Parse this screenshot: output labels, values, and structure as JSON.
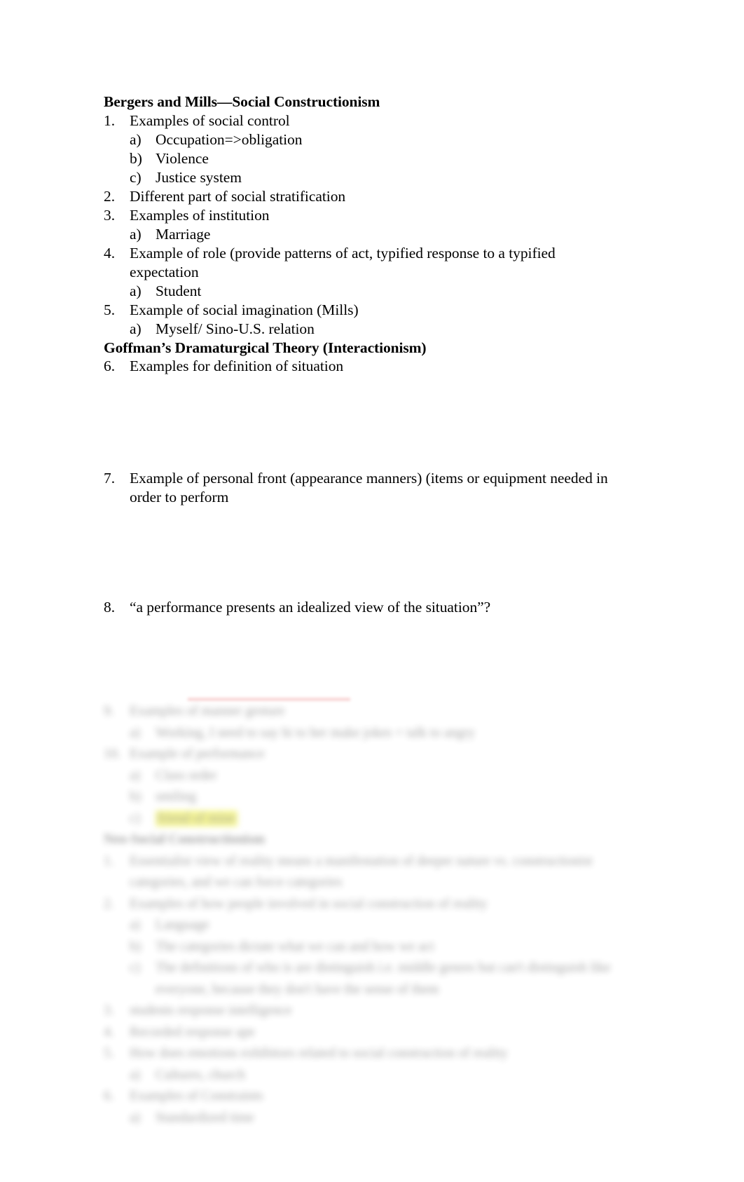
{
  "document": {
    "sections": [
      {
        "id": "section-1",
        "heading": "Bergers and Mills—Social Constructionism",
        "items": [
          {
            "marker": "1.",
            "level": 1,
            "text": "Examples of social control"
          },
          {
            "marker": "a)",
            "level": 2,
            "text": "Occupation=>obligation"
          },
          {
            "marker": "b)",
            "level": 2,
            "text": "Violence"
          },
          {
            "marker": "c)",
            "level": 2,
            "text": "Justice system"
          },
          {
            "marker": "2.",
            "level": 1,
            "text": "Different part of social stratification"
          },
          {
            "marker": "3.",
            "level": 1,
            "text": "Examples of institution"
          },
          {
            "marker": "a)",
            "level": 2,
            "text": "Marriage"
          },
          {
            "marker": "4.",
            "level": 1,
            "text": "Example of role (provide patterns of act, typified response to a typified expectation"
          },
          {
            "marker": "a)",
            "level": 2,
            "text": "Student"
          },
          {
            "marker": "5.",
            "level": 1,
            "text": "Example of social imagination (Mills)"
          },
          {
            "marker": "a)",
            "level": 2,
            "text": "Myself/ Sino-U.S. relation"
          }
        ]
      },
      {
        "id": "section-2",
        "heading": "Goffman’s Dramaturgical Theory (Interactionism)",
        "items": [
          {
            "marker": "6.",
            "level": 1,
            "text": "Examples for definition of situation"
          },
          {
            "marker": "7.",
            "level": 1,
            "text": "Example of personal front (appearance manners) (items or equipment needed in order to perform"
          },
          {
            "marker": "8.",
            "level": 1,
            "text": "“a performance presents an idealized view of the situation”?"
          }
        ]
      }
    ],
    "blurred_sections": [
      {
        "id": "blurred-section-1",
        "heading": "",
        "items": [
          {
            "marker": "9.",
            "level": 1,
            "text": "Examples of manner gesture"
          },
          {
            "marker": "a)",
            "level": 2,
            "text": "Working, I need to say hi to her make jokes + talk to angry"
          },
          {
            "marker": "10.",
            "level": 1,
            "text": "Example of performance"
          },
          {
            "marker": "a)",
            "level": 2,
            "text": "Class  order"
          },
          {
            "marker": "b)",
            "level": 2,
            "text": "smiling"
          },
          {
            "marker": "c)",
            "level": 2,
            "text": "friend of mine",
            "highlight": true
          }
        ]
      },
      {
        "id": "blurred-section-2",
        "heading": "Neo-Social Constructionism",
        "items": [
          {
            "marker": "1.",
            "level": 1,
            "text": "Essentialist view of reality means a manifestation of deeper nature vs. constructionist categories, and we can force categories"
          },
          {
            "marker": "2.",
            "level": 1,
            "text": "Examples of how people involved in social construction of reality"
          },
          {
            "marker": "a)",
            "level": 2,
            "text": "Language"
          },
          {
            "marker": "b)",
            "level": 2,
            "text": "The categories dictate what we can and how we act"
          },
          {
            "marker": "c)",
            "level": 2,
            "text": "The definitions of who is are distinguish i.e. middle genres but can't distinguish like everyone, because they don't have the sense of them"
          },
          {
            "marker": "3.",
            "level": 1,
            "text": "students response intelligence"
          },
          {
            "marker": "4.",
            "level": 1,
            "text": "Recorded response ape"
          },
          {
            "marker": "5.",
            "level": 1,
            "text": "How does emotions exhibitors related to social construction of reality"
          },
          {
            "marker": "a)",
            "level": 2,
            "text": "Cultures, church"
          },
          {
            "marker": "6.",
            "level": 1,
            "text": "Examples of Constraints"
          },
          {
            "marker": "a)",
            "level": 2,
            "text": "Standardized time"
          }
        ]
      }
    ]
  },
  "colors": {
    "text": "#000000",
    "highlight": "#e9e900",
    "underline": "#f3b4b4",
    "page_background": "#ffffff"
  }
}
